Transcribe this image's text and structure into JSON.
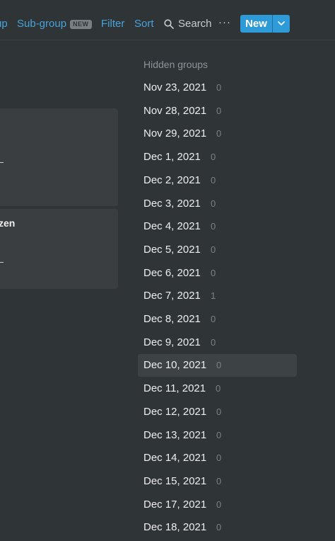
{
  "toolbar": {
    "group_label": "up",
    "subgroup_label": "Sub-group",
    "subgroup_badge": "NEW",
    "filter_label": "Filter",
    "sort_label": "Sort",
    "search_label": "Search",
    "more_label": "···",
    "new_label": "New"
  },
  "cards": [
    {
      "title": ""
    },
    {
      "title": "zen"
    }
  ],
  "hidden_groups": {
    "title": "Hidden groups",
    "items": [
      {
        "label": "Nov 23, 2021",
        "count": "0"
      },
      {
        "label": "Nov 28, 2021",
        "count": "0"
      },
      {
        "label": "Nov 29, 2021",
        "count": "0"
      },
      {
        "label": "Dec 1, 2021",
        "count": "0"
      },
      {
        "label": "Dec 2, 2021",
        "count": "0"
      },
      {
        "label": "Dec 3, 2021",
        "count": "0"
      },
      {
        "label": "Dec 4, 2021",
        "count": "0"
      },
      {
        "label": "Dec 5, 2021",
        "count": "0"
      },
      {
        "label": "Dec 6, 2021",
        "count": "0"
      },
      {
        "label": "Dec 7, 2021",
        "count": "1"
      },
      {
        "label": "Dec 8, 2021",
        "count": "0"
      },
      {
        "label": "Dec 9, 2021",
        "count": "0"
      },
      {
        "label": "Dec 10, 2021",
        "count": "0"
      },
      {
        "label": "Dec 11, 2021",
        "count": "0"
      },
      {
        "label": "Dec 12, 2021",
        "count": "0"
      },
      {
        "label": "Dec 13, 2021",
        "count": "0"
      },
      {
        "label": "Dec 14, 2021",
        "count": "0"
      },
      {
        "label": "Dec 15, 2021",
        "count": "0"
      },
      {
        "label": "Dec 17, 2021",
        "count": "0"
      },
      {
        "label": "Dec 18, 2021",
        "count": "0"
      }
    ],
    "active_index": 12
  },
  "colors": {
    "background": "#2f3437",
    "accent": "#2e9ad8",
    "link": "#4aa3d8",
    "card": "#3a3e41",
    "active_row": "#3d4245"
  }
}
